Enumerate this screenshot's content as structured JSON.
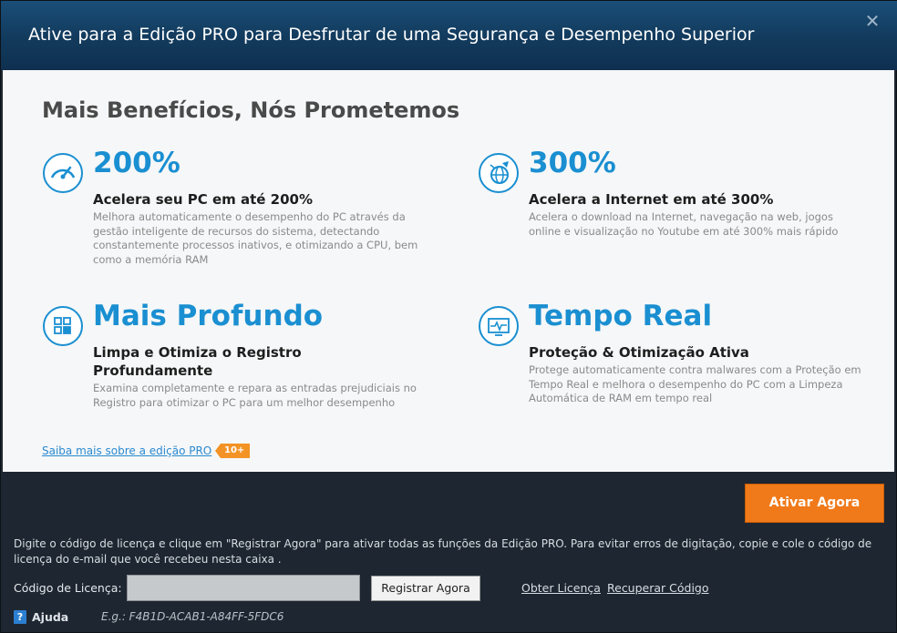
{
  "window": {
    "title": "Ative para a Edição PRO para Desfrutar de uma Segurança e Desempenho Superior",
    "close_icon": "close-icon"
  },
  "main": {
    "heading": "Mais Benefícios, Nós Prometemos",
    "features": [
      {
        "icon": "speedometer-icon",
        "big": "200%",
        "sub": "Acelera seu PC em até 200%",
        "desc": "Melhora automaticamente o desempenho do PC através da gestão inteligente de recursos do sistema, detectando constantemente processos inativos, e otimizando a CPU, bem como a memória RAM"
      },
      {
        "icon": "rocket-globe-icon",
        "big": "300%",
        "sub": "Acelera a Internet em até 300%",
        "desc": "Acelera o download na Internet, navegação na web, jogos online e visualização no Youtube em até 300% mais rápido"
      },
      {
        "icon": "registry-grid-icon",
        "big": "Mais Profundo",
        "sub": "Limpa e Otimiza o Registro Profundamente",
        "desc": "Examina completamente e repara as entradas prejudiciais no Registro para otimizar o PC para um melhor desempenho"
      },
      {
        "icon": "monitor-pulse-icon",
        "big": "Tempo Real",
        "sub": "Proteção & Otimização Ativa",
        "desc": "Protege automaticamente contra malwares com a Proteção em Tempo Real e melhora o desempenho do PC com a Limpeza Automática de RAM em tempo real"
      }
    ],
    "learn_more": "Saiba mais sobre a edição PRO",
    "badge": "10+"
  },
  "footer": {
    "activate_label": "Ativar Agora",
    "info": "Digite o código de licença e clique em \"Registrar Agora\" para ativar todas as funções da Edição PRO. Para evitar erros de digitação, copie e cole o código de licença do e-mail que você recebeu nesta caixa .",
    "license_label": "Código de Licença:",
    "license_value": "",
    "register_label": "Registrar Agora",
    "get_license": "Obter Licença",
    "recover_code": "Recuperar Código",
    "help_label": "Ajuda",
    "example": "E.g.: F4B1D-ACAB1-A84FF-5FDC6"
  },
  "colors": {
    "accent_blue": "#1a8fd1",
    "activate_orange": "#f07a1a",
    "badge_orange": "#f39325",
    "titlebar": "#153f63"
  }
}
